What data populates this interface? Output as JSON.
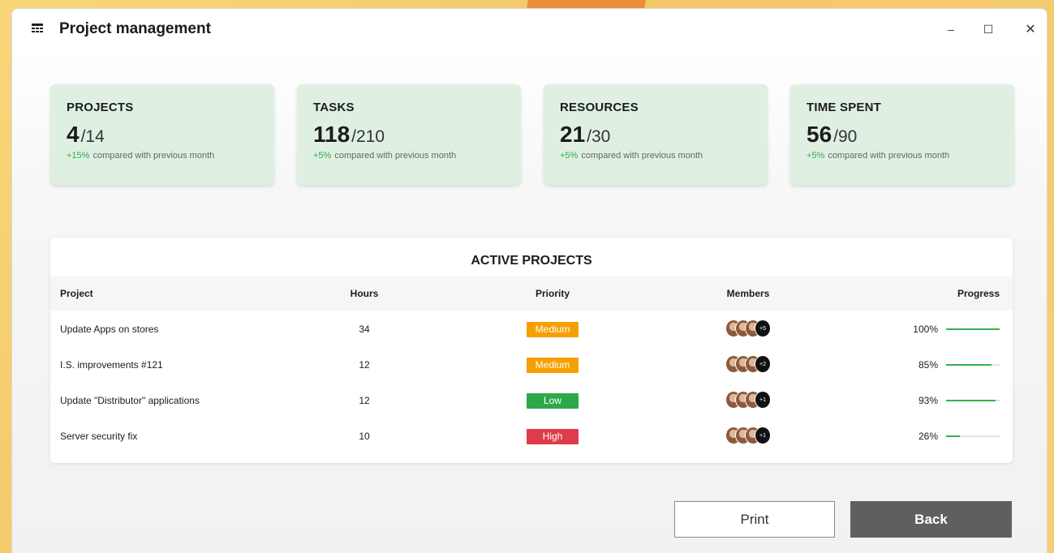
{
  "window": {
    "title": "Project management",
    "controls": {
      "minimize": "–",
      "maximize": "☐",
      "close": "✕"
    }
  },
  "stats": [
    {
      "label": "PROJECTS",
      "value": "4",
      "total": "/14",
      "change": "+15%",
      "caption": "compared with previous month"
    },
    {
      "label": "TASKS",
      "value": "118",
      "total": "/210",
      "change": "+5%",
      "caption": "compared with previous month"
    },
    {
      "label": "RESOURCES",
      "value": "21",
      "total": "/30",
      "change": "+5%",
      "caption": "compared with previous month"
    },
    {
      "label": "TIME SPENT",
      "value": "56",
      "total": "/90",
      "change": "+5%",
      "caption": "compared with previous month"
    }
  ],
  "projects_panel": {
    "title": "ACTIVE PROJECTS",
    "columns": {
      "project": "Project",
      "hours": "Hours",
      "priority": "Priority",
      "members": "Members",
      "progress": "Progress"
    },
    "rows": [
      {
        "project": "Update Apps on stores",
        "hours": "34",
        "priority": "Medium",
        "priority_color": "#f5a000",
        "members_extra": "+5",
        "progress_text": "100%",
        "progress": 1.0
      },
      {
        "project": "I.S. improvements #121",
        "hours": "12",
        "priority": "Medium",
        "priority_color": "#f5a000",
        "members_extra": "+2",
        "progress_text": "85%",
        "progress": 0.85
      },
      {
        "project": "Update \"Distributor\" applications",
        "hours": "12",
        "priority": "Low",
        "priority_color": "#2ea84a",
        "members_extra": "+1",
        "progress_text": "93%",
        "progress": 0.93
      },
      {
        "project": "Server security fix",
        "hours": "10",
        "priority": "High",
        "priority_color": "#e03b4a",
        "members_extra": "+1",
        "progress_text": "26%",
        "progress": 0.26
      }
    ]
  },
  "buttons": {
    "print": "Print",
    "back": "Back"
  },
  "colors": {
    "stat_bg": "#dff0e2",
    "positive_change": "#2eac4a",
    "progress_fill": "#35b24a",
    "back_button": "#5f5f5f"
  }
}
